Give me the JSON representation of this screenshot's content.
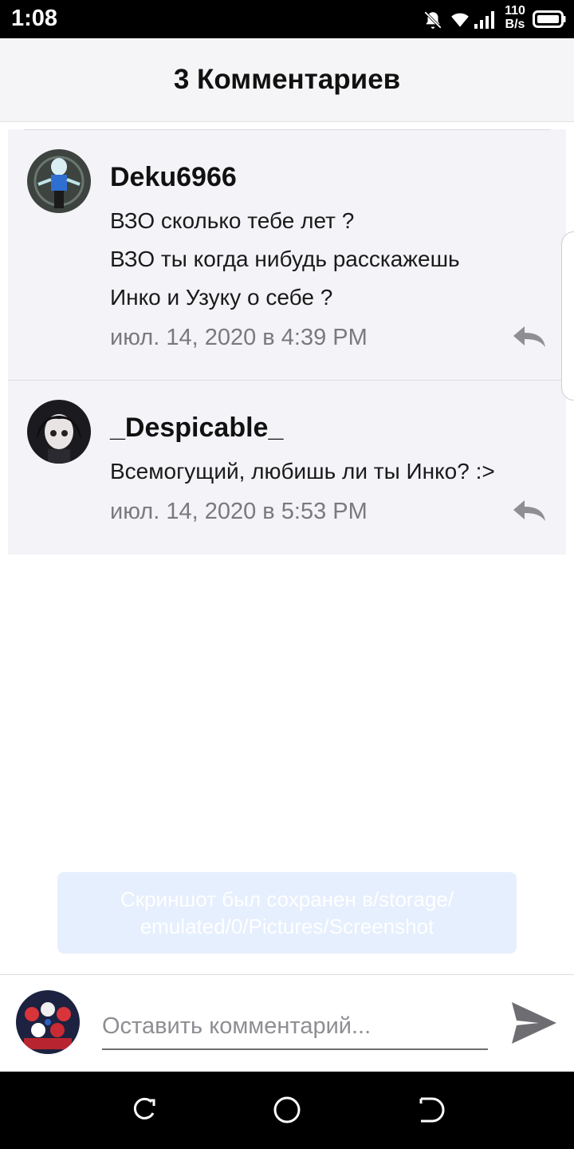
{
  "status_bar": {
    "time": "1:08",
    "speed_value": "110",
    "speed_unit": "B/s",
    "icons": [
      "bell-off-icon",
      "wifi-icon",
      "signal-icon",
      "battery-icon"
    ]
  },
  "header": {
    "title": "3 Комментариев"
  },
  "comments": [
    {
      "author": "Deku6966",
      "lines": [
        "ВЗО сколько тебе лет ?",
        "ВЗО ты когда нибудь расскажешь",
        "Инко и Узуку о себе ?"
      ],
      "date": "июл. 14, 2020 в 4:39 PM"
    },
    {
      "author": "_Despicable_",
      "lines": [
        "Всемогущий, любишь ли ты Инко? :>"
      ],
      "date": "июл. 14, 2020 в 5:53 PM"
    }
  ],
  "toast": {
    "line1": "Скриншот был сохранен в/storage/",
    "line2": "emulated/0/Pictures/Screenshot"
  },
  "composer": {
    "placeholder": "Оставить комментарий..."
  },
  "colors": {
    "comment_bg": "#f4f3f7",
    "toast_bg": "#e6effd",
    "icon_gray": "#8e8e93"
  }
}
